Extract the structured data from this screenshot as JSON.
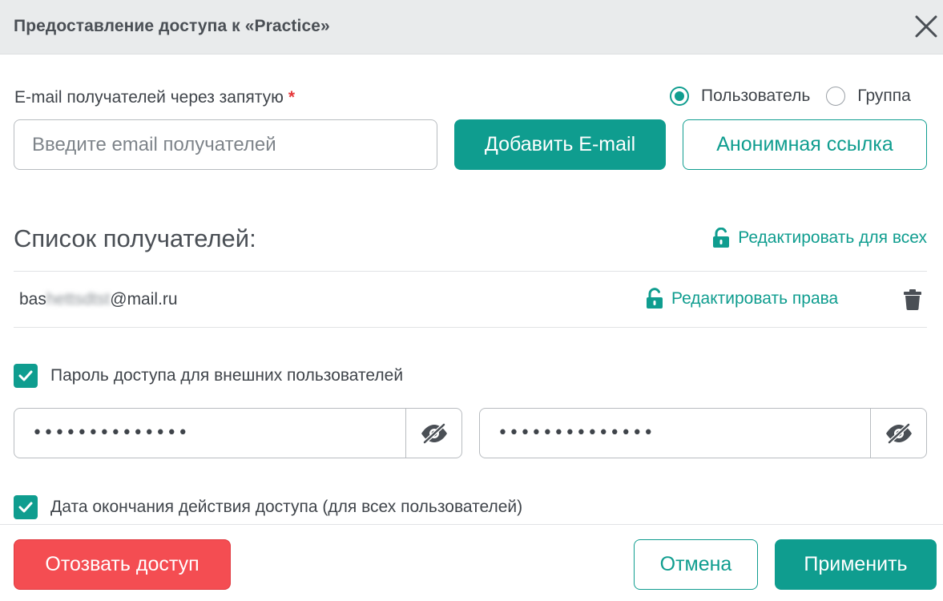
{
  "header": {
    "title": "Предоставление доступа к «Practice»",
    "close_icon": "close-icon"
  },
  "email_section": {
    "label": "E-mail получателей через запятую",
    "required_mark": "*",
    "input_placeholder": "Введите email получателей",
    "input_value": "",
    "add_button_label": "Добавить E-mail",
    "anon_link_button_label": "Анонимная ссылка",
    "recipient_type": {
      "options": [
        {
          "label": "Пользователь",
          "selected": true
        },
        {
          "label": "Группа",
          "selected": false
        }
      ]
    }
  },
  "recipients": {
    "title": "Список получателей:",
    "edit_all_label": "Редактировать для всех",
    "edit_all_icon": "unlock-icon",
    "items": [
      {
        "email_start": "bas",
        "email_hidden": "hettsdtst",
        "email_end": "@mail.ru",
        "edit_rights_label": "Редактировать права",
        "edit_rights_icon": "unlock-icon",
        "delete_icon": "trash-icon"
      }
    ]
  },
  "password_section": {
    "checkbox_label": "Пароль доступа для внешних пользователей",
    "checked": true,
    "password_value": "••••••••••••••",
    "password_confirm_value": "••••••••••••••",
    "toggle_icon": "eye-slash-icon"
  },
  "expiry_section": {
    "checkbox_label": "Дата окончания действия доступа (для всех пользователей)",
    "checked": true
  },
  "footer": {
    "revoke_label": "Отозвать доступ",
    "cancel_label": "Отмена",
    "apply_label": "Применить"
  },
  "colors": {
    "accent": "#0f9d8f",
    "danger": "#f44d52",
    "header_bg": "#e9ebec",
    "required": "#e5383b"
  }
}
